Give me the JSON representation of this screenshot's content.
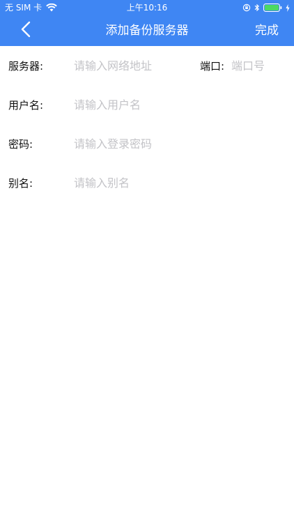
{
  "status_bar": {
    "carrier": "无 SIM 卡",
    "time": "上午10:16"
  },
  "nav": {
    "title": "添加备份服务器",
    "done_label": "完成"
  },
  "form": {
    "server": {
      "label": "服务器:",
      "placeholder": "请输入网络地址",
      "value": ""
    },
    "port": {
      "label": "端口:",
      "placeholder": "端口号",
      "value": ""
    },
    "username": {
      "label": "用户名:",
      "placeholder": "请输入用户名",
      "value": ""
    },
    "password": {
      "label": "密码:",
      "placeholder": "请输入登录密码",
      "value": ""
    },
    "alias": {
      "label": "别名:",
      "placeholder": "请输入别名",
      "value": ""
    }
  },
  "colors": {
    "header_bg": "#3f86f3",
    "header_text": "#ffffff",
    "placeholder": "#c3c3c7",
    "label": "#111111",
    "battery_fill": "#4cd964"
  },
  "icons": [
    "wifi-icon",
    "lock-rotation-icon",
    "bluetooth-icon",
    "battery-icon",
    "charging-icon",
    "back-chevron-icon"
  ]
}
